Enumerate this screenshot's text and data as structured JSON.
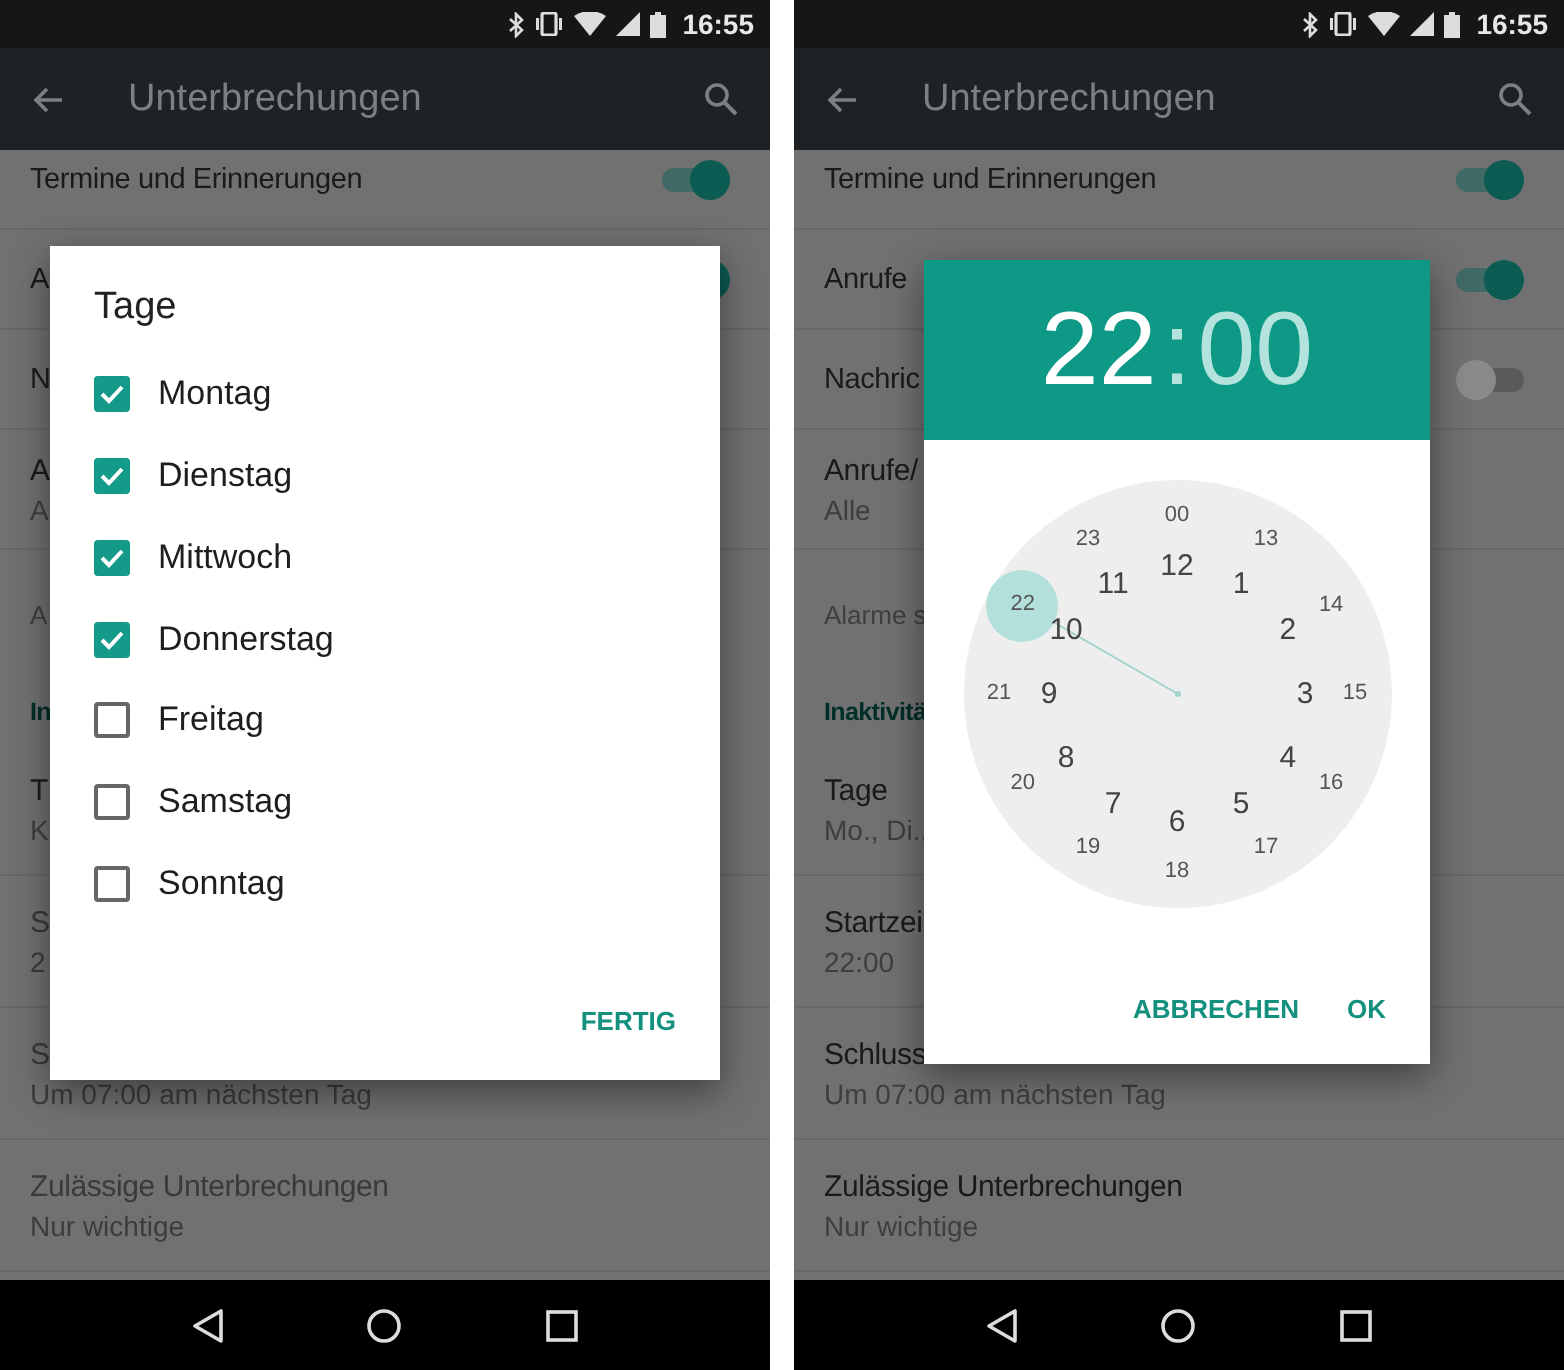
{
  "screens": [
    {
      "status_bar": {
        "time": "16:55"
      },
      "toolbar": {
        "title": "Unterbrechungen"
      },
      "rows": [
        {
          "kind": "switch",
          "title": "Termine und Erinnerungen",
          "on": true
        },
        {
          "kind": "switch",
          "title": "A",
          "on": true
        },
        {
          "kind": "plain",
          "title": "N"
        },
        {
          "kind": "two-line",
          "title": "A",
          "subtitle": "A",
          "disabled": false
        },
        {
          "kind": "note",
          "title": "A"
        },
        {
          "kind": "header",
          "title": "In"
        },
        {
          "kind": "two-line",
          "title": "T",
          "subtitle": "K",
          "disabled": false
        },
        {
          "kind": "two-line",
          "title": "S",
          "subtitle": "2",
          "disabled": true
        },
        {
          "kind": "two-line",
          "title": "S",
          "subtitle": "Um 07:00 am nächsten Tag",
          "disabled": true
        },
        {
          "kind": "two-line",
          "title": "Zulässige Unterbrechungen",
          "subtitle": "Nur wichtige",
          "disabled": true
        }
      ],
      "dialog": {
        "kind": "checklist",
        "title": "Tage",
        "items": [
          {
            "label": "Montag",
            "checked": true
          },
          {
            "label": "Dienstag",
            "checked": true
          },
          {
            "label": "Mittwoch",
            "checked": true
          },
          {
            "label": "Donnerstag",
            "checked": true
          },
          {
            "label": "Freitag",
            "checked": false
          },
          {
            "label": "Samstag",
            "checked": false
          },
          {
            "label": "Sonntag",
            "checked": false
          }
        ],
        "buttons": [
          "FERTIG"
        ]
      }
    },
    {
      "status_bar": {
        "time": "16:55"
      },
      "toolbar": {
        "title": "Unterbrechungen"
      },
      "rows": [
        {
          "kind": "switch",
          "title": "Termine und Erinnerungen",
          "on": true
        },
        {
          "kind": "switch",
          "title": "Anrufe",
          "on": true
        },
        {
          "kind": "switch",
          "title": "Nachric",
          "on": false
        },
        {
          "kind": "two-line",
          "title": "Anrufe/",
          "subtitle": "Alle",
          "disabled": false
        },
        {
          "kind": "note",
          "title": "Alarme s"
        },
        {
          "kind": "header",
          "title": "Inaktivitä"
        },
        {
          "kind": "two-line",
          "title": "Tage",
          "subtitle": "Mo., Di.,",
          "disabled": false
        },
        {
          "kind": "two-line",
          "title": "Startzei",
          "subtitle": "22:00",
          "disabled": false
        },
        {
          "kind": "two-line",
          "title": "Schluss",
          "subtitle": "Um 07:00 am nächsten Tag",
          "disabled": false
        },
        {
          "kind": "two-line",
          "title": "Zulässige Unterbrechungen",
          "subtitle": "Nur wichtige",
          "disabled": false
        }
      ],
      "dialog": {
        "kind": "time-picker",
        "hour": {
          "label": "22",
          "selected": true
        },
        "separator": ":",
        "minute": {
          "label": "00",
          "selected": false
        },
        "inner": [
          {
            "label": "12",
            "selected": false
          },
          {
            "label": "1",
            "selected": false
          },
          {
            "label": "2",
            "selected": false
          },
          {
            "label": "3",
            "selected": false
          },
          {
            "label": "4",
            "selected": false
          },
          {
            "label": "5",
            "selected": false
          },
          {
            "label": "6",
            "selected": false
          },
          {
            "label": "7",
            "selected": false
          },
          {
            "label": "8",
            "selected": false
          },
          {
            "label": "9",
            "selected": false
          },
          {
            "label": "10",
            "selected": false
          },
          {
            "label": "11",
            "selected": false
          }
        ],
        "outer": [
          {
            "label": "00",
            "selected": false
          },
          {
            "label": "13",
            "selected": false
          },
          {
            "label": "14",
            "selected": false
          },
          {
            "label": "15",
            "selected": false
          },
          {
            "label": "16",
            "selected": false
          },
          {
            "label": "17",
            "selected": false
          },
          {
            "label": "18",
            "selected": false
          },
          {
            "label": "19",
            "selected": false
          },
          {
            "label": "20",
            "selected": false
          },
          {
            "label": "21",
            "selected": false
          },
          {
            "label": "22",
            "selected": true
          },
          {
            "label": "23",
            "selected": false
          }
        ],
        "buttons": [
          "ABBRECHEN",
          "OK"
        ]
      }
    }
  ]
}
